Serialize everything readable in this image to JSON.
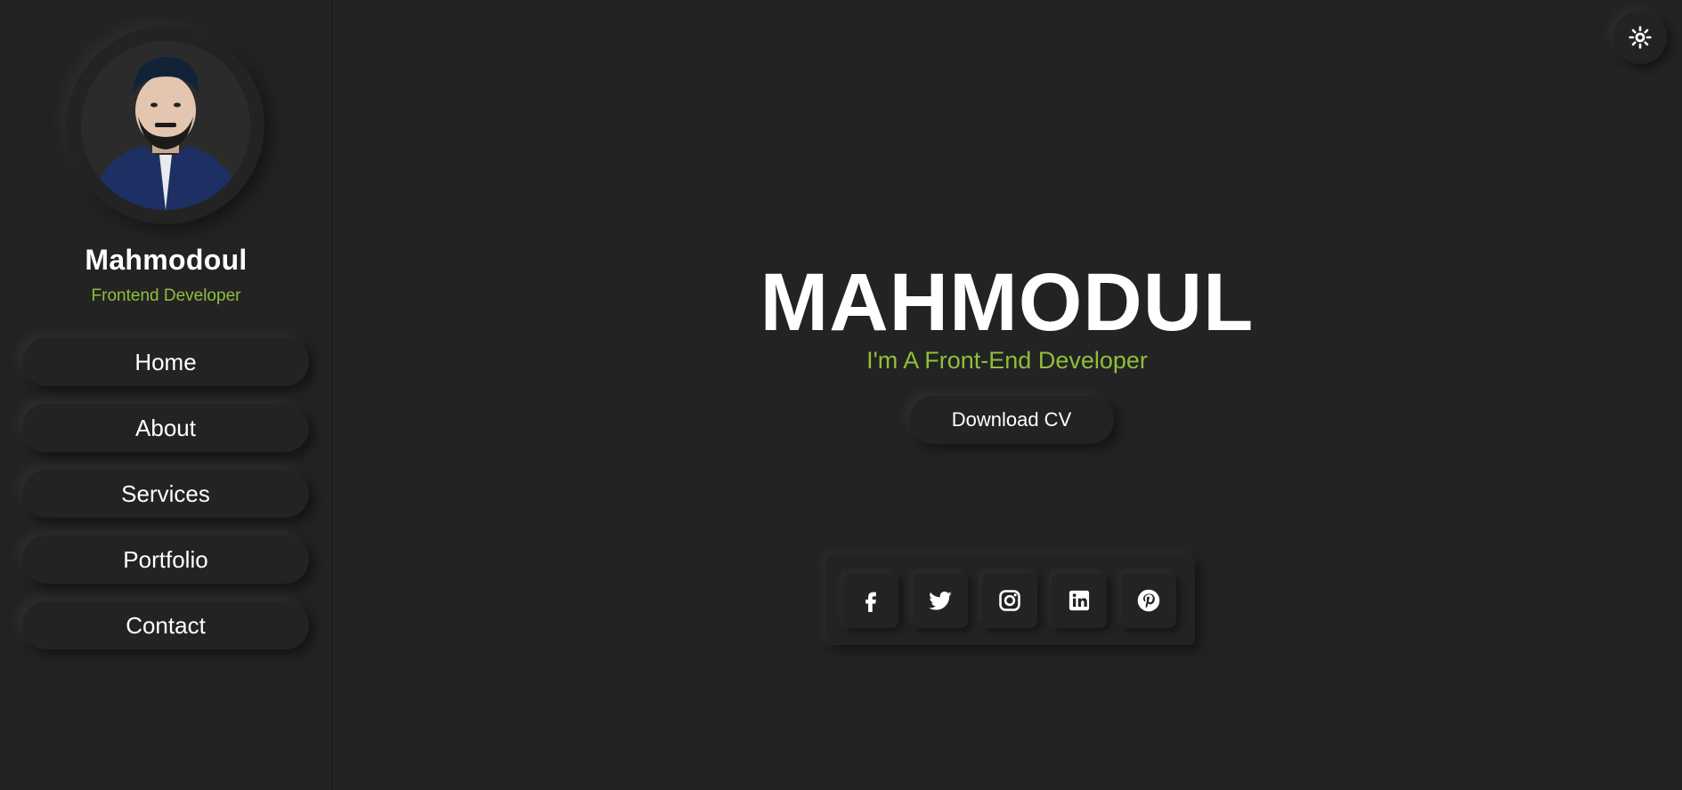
{
  "sidebar": {
    "profile": {
      "name": "Mahmodoul",
      "role": "Frontend Developer",
      "avatar_icon": "profile-photo"
    },
    "nav": [
      {
        "label": "Home"
      },
      {
        "label": "About"
      },
      {
        "label": "Services"
      },
      {
        "label": "Portfolio"
      },
      {
        "label": "Contact"
      }
    ]
  },
  "header": {
    "theme_toggle_icon": "sun-icon"
  },
  "hero": {
    "title": "MAHMODUL",
    "subtitle": "I'm A Front-End Developer",
    "cta_label": "Download CV"
  },
  "social": [
    {
      "icon": "facebook-icon"
    },
    {
      "icon": "twitter-icon"
    },
    {
      "icon": "instagram-icon"
    },
    {
      "icon": "linkedin-icon"
    },
    {
      "icon": "pinterest-icon"
    }
  ],
  "colors": {
    "background": "#232323",
    "accent": "#8fbf3a",
    "text": "#ffffff"
  }
}
